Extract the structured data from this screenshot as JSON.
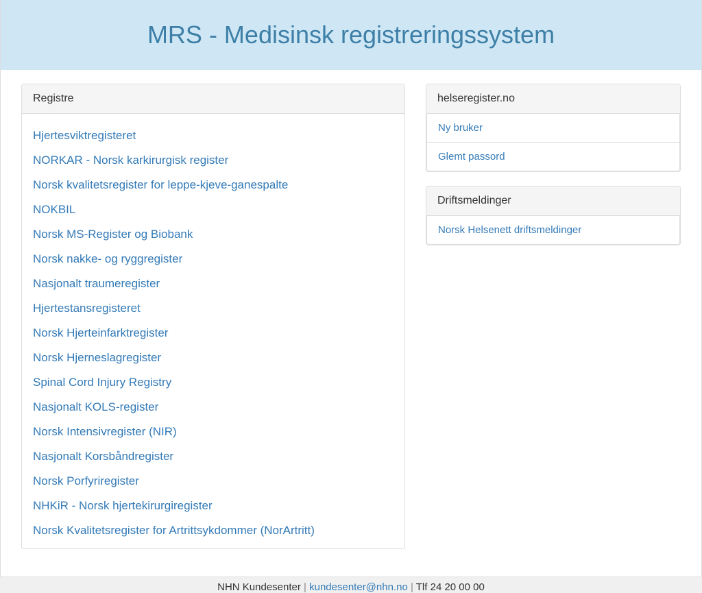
{
  "header": {
    "title": "MRS - Medisinsk registreringssystem"
  },
  "registre": {
    "heading": "Registre",
    "items": [
      {
        "label": "Hjertesviktregisteret"
      },
      {
        "label": "NORKAR - Norsk karkirurgisk register"
      },
      {
        "label": "Norsk kvalitetsregister for leppe-kjeve-ganespalte"
      },
      {
        "label": "NOKBIL"
      },
      {
        "label": "Norsk MS-Register og Biobank"
      },
      {
        "label": "Norsk nakke- og ryggregister"
      },
      {
        "label": "Nasjonalt traumeregister"
      },
      {
        "label": "Hjertestansregisteret"
      },
      {
        "label": "Norsk Hjerteinfarktregister"
      },
      {
        "label": "Norsk Hjerneslagregister"
      },
      {
        "label": "Spinal Cord Injury Registry"
      },
      {
        "label": "Nasjonalt KOLS-register"
      },
      {
        "label": "Norsk Intensivregister (NIR)"
      },
      {
        "label": "Nasjonalt Korsbåndregister"
      },
      {
        "label": "Norsk Porfyriregister"
      },
      {
        "label": "NHKiR - Norsk hjertekirurgiregister"
      },
      {
        "label": "Norsk Kvalitetsregister for Artrittsykdommer (NorArtritt)"
      }
    ]
  },
  "helseregister": {
    "heading": "helseregister.no",
    "items": [
      {
        "label": "Ny bruker"
      },
      {
        "label": "Glemt passord"
      }
    ]
  },
  "driftsmeldinger": {
    "heading": "Driftsmeldinger",
    "items": [
      {
        "label": "Norsk Helsenett driftsmeldinger"
      }
    ]
  },
  "footer": {
    "org": "NHN Kundesenter",
    "email": "kundesenter@nhn.no",
    "phone_label": "Tlf 24 20 00 00",
    "sep": " | "
  }
}
